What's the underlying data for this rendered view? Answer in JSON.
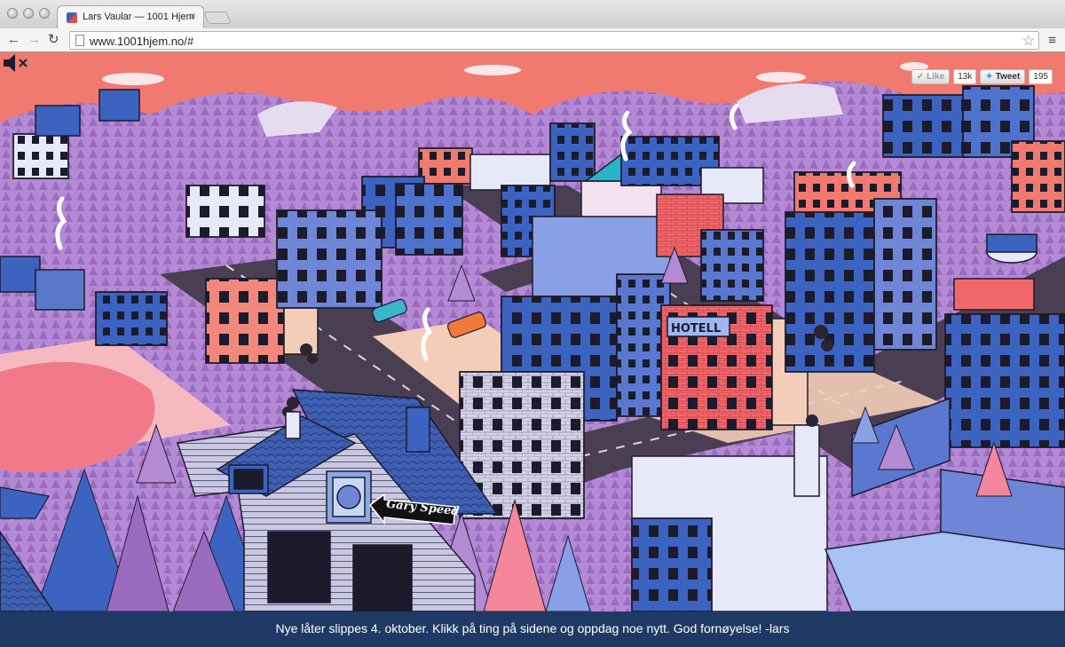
{
  "browser": {
    "tab_title": "Lars Vaular — 1001 Hjem",
    "tab_close": "×",
    "url": "www.1001hjem.no/#",
    "back_glyph": "←",
    "forward_glyph": "→",
    "reload_glyph": "↻",
    "star_glyph": "☆",
    "menu_glyph": "≡"
  },
  "page": {
    "mute_icon": "speaker-muted-icon",
    "social": {
      "like_label": "Like",
      "like_count": "13k",
      "tweet_label": "Tweet",
      "tweet_count": "195"
    },
    "hotel_sign": "HOTELL",
    "hover_label": "Gary Speed",
    "footer_text": "Nye låter slippes 4. oktober. Klikk på ting på sidene og oppdag noe nytt. God fornøyelse! -lars"
  },
  "colors": {
    "sky": "#f07a70",
    "hills": "#b48ad4",
    "road": "#4a3e52",
    "sidewalk": "#f4cdb8",
    "building_blue": "#3c63c0",
    "footer_bg": "#1e3a64"
  }
}
